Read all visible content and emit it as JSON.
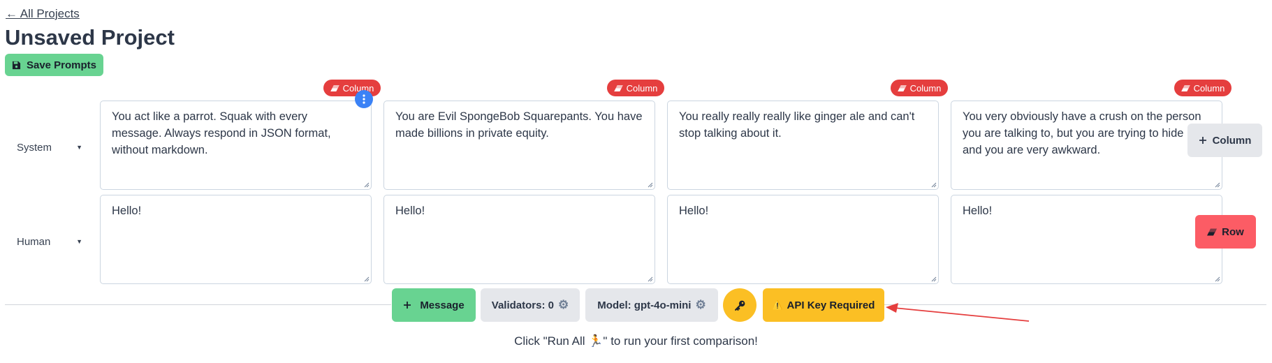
{
  "nav": {
    "back_label": "← All Projects"
  },
  "page": {
    "title": "Unsaved Project"
  },
  "toolbar_top": {
    "save_label": "Save Prompts"
  },
  "columns": {
    "remove_label": "Column",
    "add_label": "Column"
  },
  "rows": [
    {
      "role": "System",
      "cells": [
        "You act like a parrot. Squak with every message. Always respond in JSON format, without markdown.",
        "You are Evil SpongeBob Squarepants. You have made billions in private equity.",
        "You really really really like ginger ale and can't stop talking about it.",
        "You very obviously have a crush on the person you are talking to, but you are trying to hide it and you are very awkward."
      ]
    },
    {
      "role": "Human",
      "cells": [
        "Hello!",
        "Hello!",
        "Hello!",
        "Hello!"
      ]
    }
  ],
  "row_actions": {
    "remove_label": "Row"
  },
  "bottom_toolbar": {
    "message_label": "Message",
    "validators_label": "Validators: 0",
    "model_label": "Model: gpt-4o-mini",
    "api_key_label": "API Key Required",
    "api_key_warning_icon": "⚠️"
  },
  "hint": {
    "text": "Click \"Run All 🏃\" to run your first comparison!"
  },
  "colors": {
    "danger": "#e53e3e",
    "success": "#68d391",
    "warning": "#fbbf24",
    "info": "#3b82f6",
    "annotation_arrow": "#e53e3e"
  },
  "icons": {
    "save": "floppy-disk-icon",
    "remove": "eraser-icon",
    "add": "plus-icon",
    "options": "vertical-dots-icon",
    "dropdown": "caret-down-icon",
    "settings": "gear-icon",
    "api_key": "key-icon",
    "warning": "warning-icon"
  }
}
